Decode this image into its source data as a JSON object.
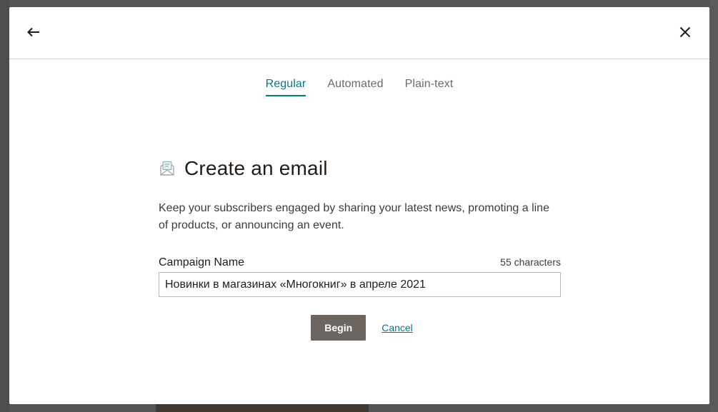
{
  "modal": {
    "back_icon": "arrow-left-icon",
    "close_icon": "close-icon"
  },
  "tabs": [
    {
      "label": "Regular",
      "active": true
    },
    {
      "label": "Automated",
      "active": false
    },
    {
      "label": "Plain-text",
      "active": false
    }
  ],
  "form": {
    "title_icon": "email-envelope-icon",
    "title": "Create an email",
    "description": "Keep your subscribers engaged by sharing your latest news, promoting a line of products, or announcing an event.",
    "field_label": "Campaign Name",
    "char_count": "55 characters",
    "campaign_name_value": "Новинки в магазинах «Многокниг» в апреле 2021",
    "begin_label": "Begin",
    "cancel_label": "Cancel"
  },
  "colors": {
    "accent": "#007c89",
    "button_bg": "#6d6660",
    "overlay": "#555555"
  }
}
